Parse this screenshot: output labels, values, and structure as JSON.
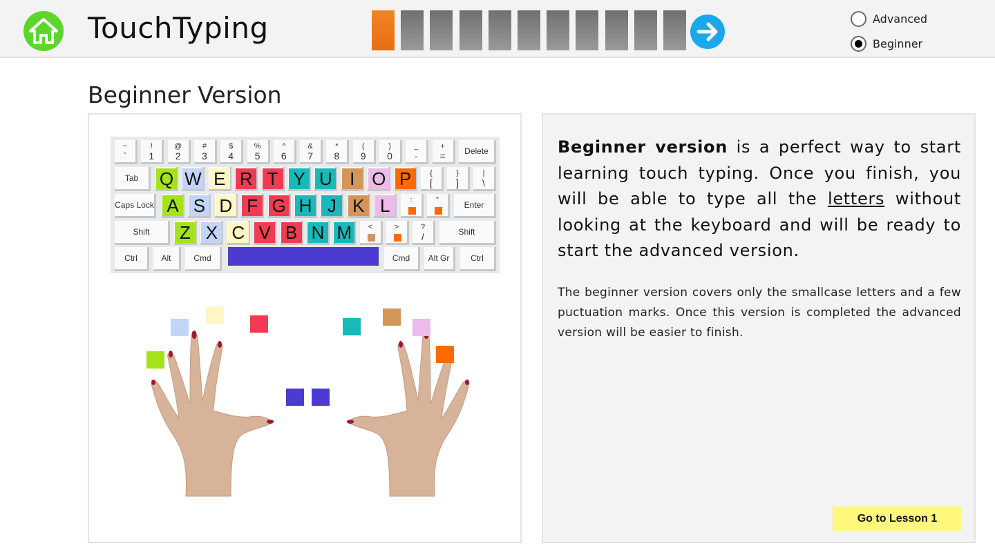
{
  "app": {
    "title": "TouchTyping"
  },
  "header": {
    "progress_total": 11,
    "progress_current": 1,
    "progress_active_color": "#ec6c12",
    "progress_inactive_color": "#7d7d7d",
    "version_options": [
      {
        "label": "Advanced",
        "selected": false
      },
      {
        "label": "Beginner",
        "selected": true
      }
    ]
  },
  "page": {
    "title": "Beginner Version"
  },
  "keyboard": {
    "number_row": [
      {
        "top": "~",
        "bottom": "`"
      },
      {
        "top": "!",
        "bottom": "1"
      },
      {
        "top": "@",
        "bottom": "2"
      },
      {
        "top": "#",
        "bottom": "3"
      },
      {
        "top": "$",
        "bottom": "4"
      },
      {
        "top": "%",
        "bottom": "5"
      },
      {
        "top": "^",
        "bottom": "6"
      },
      {
        "top": "&",
        "bottom": "7"
      },
      {
        "top": "*",
        "bottom": "8"
      },
      {
        "top": "(",
        "bottom": "9"
      },
      {
        "top": ")",
        "bottom": "0"
      },
      {
        "top": "_",
        "bottom": "-"
      },
      {
        "top": "+",
        "bottom": "="
      }
    ],
    "delete_label": "Delete",
    "tab_label": "Tab",
    "caps_label": "Caps Lock",
    "enter_label": "Enter",
    "shift_label": "Shift",
    "bracket_keys": [
      {
        "top": "{",
        "bottom": "["
      },
      {
        "top": "}",
        "bottom": "]"
      },
      {
        "top": "|",
        "bottom": "\\"
      }
    ],
    "slash_key": {
      "top": "?",
      "bottom": "/"
    },
    "top_letters": [
      "Q",
      "W",
      "E",
      "R",
      "T",
      "Y",
      "U",
      "I",
      "O",
      "P"
    ],
    "home_letters": [
      "A",
      "S",
      "D",
      "F",
      "G",
      "H",
      "J",
      "K",
      "L"
    ],
    "bottom_letters": [
      "Z",
      "X",
      "C",
      "V",
      "B",
      "N",
      "M"
    ],
    "home_punct": [
      {
        "top": ":",
        "bottom": ";",
        "color": "#ff6a00"
      },
      {
        "top": "\"",
        "bottom": "'",
        "color": "#ff6a00"
      }
    ],
    "bottom_punct": [
      {
        "top": "<",
        "bottom": ",",
        "color": "#d4955a"
      },
      {
        "top": ">",
        "bottom": ".",
        "color": "#ff6a00"
      }
    ],
    "bottom_row": [
      "Ctrl",
      "Alt",
      "Cmd",
      "Cmd",
      "Alt Gr",
      "Ctrl"
    ],
    "finger_colors": {
      "left_pinky": "#a4e21a",
      "left_ring": "#c2d4f7",
      "left_middle": "#fef7c4",
      "left_index": "#f23b52",
      "thumbs": "#4c3bd0",
      "right_index": "#19b9b9",
      "right_middle": "#d4955a",
      "right_ring": "#ebbce8",
      "right_pinky": "#ff6a00"
    }
  },
  "info": {
    "bold_lead": "Beginner version",
    "text_part1": " is a perfect way to start learning touch typing. Once you finish, you will be able to type all the ",
    "underlined": "letters",
    "text_part2": " without looking at the keyboard and will be ready to start the advanced version.",
    "secondary": "The beginner version covers only the smallcase letters and a few puctuation marks. Once this version is completed the advanced version will be easier to finish.",
    "button_label": "Go to Lesson 1"
  }
}
